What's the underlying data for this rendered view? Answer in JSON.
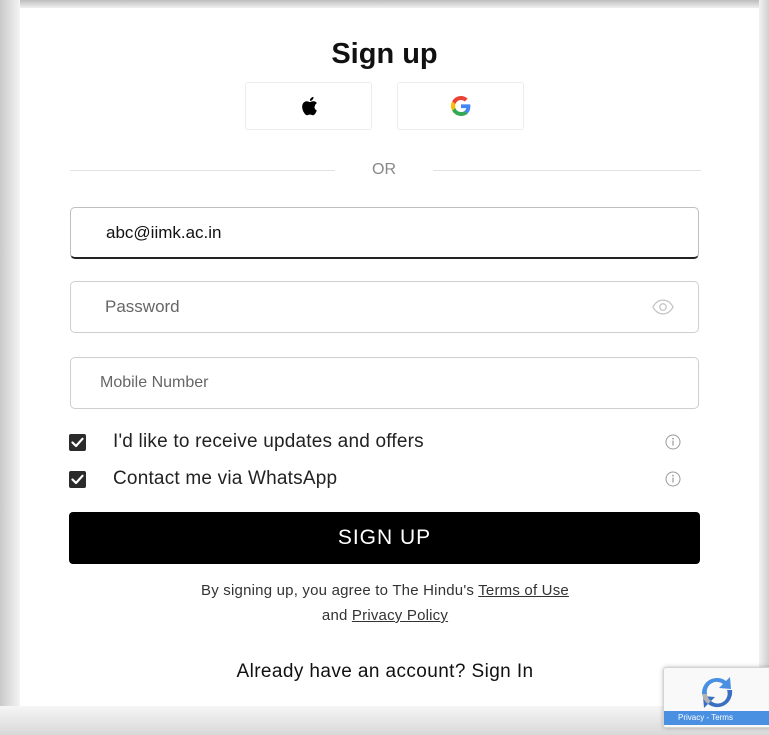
{
  "form": {
    "title": "Sign up",
    "social": {
      "apple_icon": "apple-icon",
      "google_icon": "google-icon"
    },
    "divider_text": "OR",
    "email": {
      "value": "abc@iimk.ac.in"
    },
    "password": {
      "placeholder": "Password",
      "toggle_icon": "eye-icon"
    },
    "mobile": {
      "placeholder": "Mobile Number"
    },
    "checkboxes": [
      {
        "label": "I'd like to receive updates and offers",
        "checked": true,
        "info_icon": "info-icon"
      },
      {
        "label": "Contact me via WhatsApp",
        "checked": true,
        "info_icon": "info-icon"
      }
    ],
    "submit_label": "SIGN UP",
    "legal": {
      "prefix": "By signing up, you agree to The Hindu's",
      "terms_link": "Terms of Use",
      "and": "and",
      "privacy_link": "Privacy Policy"
    },
    "signin": {
      "prompt": "Already have an account?",
      "link": "Sign In"
    }
  },
  "recaptcha": {
    "footer_text": "Privacy - Terms"
  },
  "colors": {
    "primary_button": "#000000",
    "checkbox": "#2b2b2b",
    "google_blue": "#4285F4",
    "google_red": "#EA4335",
    "google_yellow": "#FBBC05",
    "google_green": "#34A853"
  }
}
